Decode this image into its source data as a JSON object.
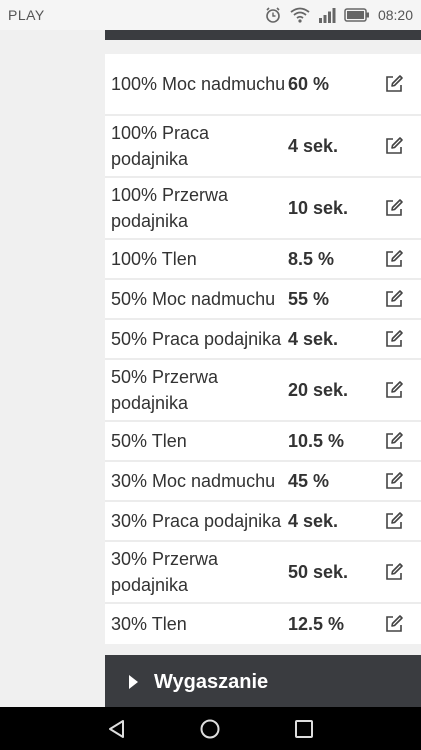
{
  "status_bar": {
    "carrier": "PLAY",
    "time": "08:20",
    "icons": [
      "alarm-icon",
      "wifi-icon",
      "signal-icon",
      "battery-icon"
    ]
  },
  "params": [
    {
      "label": "100% Moc nadmuchu",
      "value": "60 %"
    },
    {
      "label": "100% Praca podajnika",
      "value": "4 sek."
    },
    {
      "label": "100% Przerwa podajnika",
      "value": "10 sek."
    },
    {
      "label": "100% Tlen",
      "value": "8.5 %"
    },
    {
      "label": "50% Moc nadmuchu",
      "value": "55 %"
    },
    {
      "label": "50% Praca podajnika",
      "value": "4 sek."
    },
    {
      "label": "50% Przerwa podajnika",
      "value": "20 sek."
    },
    {
      "label": "50% Tlen",
      "value": "10.5 %"
    },
    {
      "label": "30% Moc nadmuchu",
      "value": "45 %"
    },
    {
      "label": "30% Praca podajnika",
      "value": "4 sek."
    },
    {
      "label": "30% Przerwa podajnika",
      "value": "50 sek."
    },
    {
      "label": "30% Tlen",
      "value": "12.5 %"
    }
  ],
  "section": {
    "title": "Wygaszanie",
    "icon": "caret-right-icon"
  },
  "nav": [
    "back-icon",
    "home-icon",
    "recents-icon"
  ],
  "colors": {
    "header_dark": "#3a3c40",
    "text": "#333333",
    "background": "#f0f0f0"
  }
}
